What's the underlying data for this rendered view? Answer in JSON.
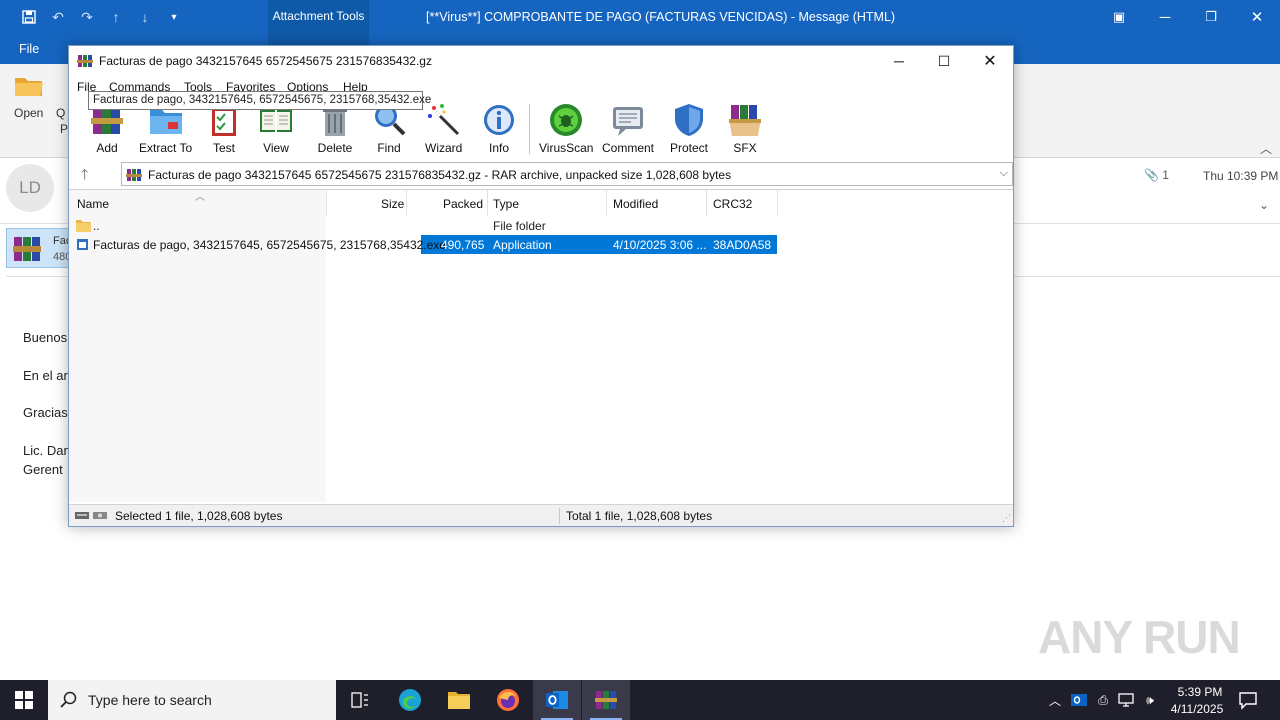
{
  "outlook": {
    "title": "[**Virus**] COMPROBANTE DE PAGO (FACTURAS VENCIDAS)  -  Message (HTML)",
    "context_tab": "Attachment Tools",
    "file_tab": "File",
    "ribbon": {
      "open_label": "Open",
      "q_label": "Q",
      "p_label": "P"
    },
    "header": {
      "avatar_initials": "LD",
      "attachment_count": "1",
      "date": "Thu 10:39 PM"
    },
    "attachment": {
      "name": "Fac",
      "size": "480"
    },
    "body_lines": [
      "Buenos",
      "En el ar",
      "Gracias",
      "Lic. Dan",
      "Gerent"
    ]
  },
  "winrar": {
    "title": "Facturas de pago 3432157645 6572545675 231576835432.gz",
    "menu": [
      "File",
      "Commands",
      "Tools",
      "Favorites",
      "Options",
      "Help"
    ],
    "toolbar": [
      {
        "label": "Add",
        "icon": "add-icon"
      },
      {
        "label": "Extract To",
        "icon": "extract-to-icon"
      },
      {
        "label": "Test",
        "icon": "test-icon"
      },
      {
        "label": "View",
        "icon": "view-icon"
      },
      {
        "label": "Delete",
        "icon": "delete-icon"
      },
      {
        "label": "Find",
        "icon": "find-icon"
      },
      {
        "label": "Wizard",
        "icon": "wizard-icon"
      },
      {
        "label": "Info",
        "icon": "info-icon"
      },
      {
        "label": "VirusScan",
        "icon": "virusscan-icon"
      },
      {
        "label": "Comment",
        "icon": "comment-icon"
      },
      {
        "label": "Protect",
        "icon": "protect-icon"
      },
      {
        "label": "SFX",
        "icon": "sfx-icon"
      }
    ],
    "path": "Facturas de pago 3432157645 6572545675 231576835432.gz - RAR archive, unpacked size 1,028,608 bytes",
    "columns": [
      "Name",
      "Size",
      "Packed",
      "Type",
      "Modified",
      "CRC32"
    ],
    "rows": [
      {
        "name": "..",
        "size": "",
        "packed": "",
        "type": "File folder",
        "modified": "",
        "crc": ""
      },
      {
        "name": "Facturas de pago, 3432157645, 6572545675, 2315768,35432.exe",
        "size": "",
        "packed": "490,765",
        "type": "Application",
        "modified": "4/10/2025 3:06 ...",
        "crc": "38AD0A58"
      }
    ],
    "tooltip": "Facturas de pago, 3432157645, 6572545675, 2315768,35432.exe",
    "status_left": "Selected 1 file, 1,028,608 bytes",
    "status_right": "Total 1 file, 1,028,608 bytes"
  },
  "watermark": "ANY RUN",
  "taskbar": {
    "search_placeholder": "Type here to search",
    "time": "5:39 PM",
    "date": "4/11/2025"
  },
  "colors": {
    "outlook_blue": "#1565c0",
    "selection_blue": "#0078d7",
    "taskbar": "#1f1f2b"
  }
}
